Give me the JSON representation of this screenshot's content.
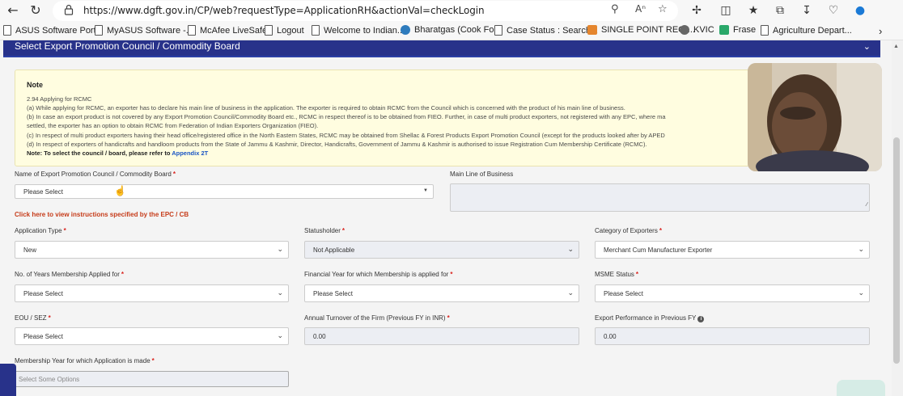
{
  "browser": {
    "url": "https://www.dgft.gov.in/CP/web?requestType=ApplicationRH&actionVal=checkLogin",
    "icons": [
      "back-icon",
      "refresh-icon",
      "lock-icon",
      "zoom-icon",
      "read-aloud-icon",
      "favorite-star-icon",
      "extensions-icon",
      "split-screen-icon",
      "favorites-icon",
      "collections-icon",
      "downloads-icon",
      "performance-icon",
      "copilot-icon"
    ]
  },
  "favorites": [
    {
      "label": "ASUS Software Port..."
    },
    {
      "label": "MyASUS Software -..."
    },
    {
      "label": "McAfee LiveSafe"
    },
    {
      "label": "Logout"
    },
    {
      "label": "Welcome to Indian..."
    },
    {
      "label": "Bharatgas (Cook Fo..."
    },
    {
      "label": "Case Status : Search..."
    },
    {
      "label": "SINGLE POINT REGI..."
    },
    {
      "label": "KVIC"
    },
    {
      "label": "Frase"
    },
    {
      "label": "Agriculture Depart..."
    }
  ],
  "section": {
    "title": "Select Export Promotion Council / Commodity Board"
  },
  "note": {
    "heading": "Note",
    "lines": [
      "2.94 Applying for RCMC",
      "(a) While applying for RCMC, an exporter has to declare his main line of business in the application. The exporter is required to obtain RCMC from the Council which is concerned with the product of his main line of business.",
      "(b) In case an export product is not covered by any Export Promotion Council/Commodity Board etc., RCMC in respect thereof is to be obtained from FIEO. Further, in case of multi product exporters, not registered with any EPC, where ma",
      "settled, the exporter has an option to obtain RCMC from Federation of Indian Exporters Organization (FIEO).",
      "(c) In respect of multi product exporters having their head office/registered office in the North Eastern States, RCMC may be obtained from Shellac & Forest Products Export Promotion Council (except for the products looked after by APED",
      "(d) In respect of exporters of handicrafts and handloom products from the State of Jammu & Kashmir, Director, Handicrafts, Government of Jammu & Kashmir is authorised to issue Registration Cum Membership Certificate (RCMC)."
    ],
    "select_note": "Note: To select the council / board, please refer to",
    "appendix_link": "Appendix 2T"
  },
  "form": {
    "epc_label": "Name of Export Promotion Council / Commodity Board",
    "epc_value": "Please Select",
    "main_line_label": "Main Line of Business",
    "instructions_link": "Click here to view instructions specified by the EPC / CB",
    "application_type_label": "Application Type",
    "application_type_value": "New",
    "statusholder_label": "Statusholder",
    "statusholder_value": "Not Applicable",
    "category_label": "Category of Exporters",
    "category_value": "Merchant Cum Manufacturer Exporter",
    "years_label": "No. of Years Membership Applied for",
    "years_value": "Please Select",
    "fin_year_label": "Financial Year for which Membership is applied for",
    "fin_year_value": "Please Select",
    "msme_label": "MSME Status",
    "msme_value": "Please Select",
    "eou_label": "EOU / SEZ",
    "eou_value": "Please Select",
    "turnover_label": "Annual Turnover of the Firm (Previous FY in INR)",
    "turnover_value": "0.00",
    "export_perf_label": "Export Performance in Previous FY",
    "export_perf_value": "0.00",
    "membership_year_label": "Membership Year for which Application is made",
    "membership_year_placeholder": "Select Some Options"
  },
  "colors": {
    "header_blue": "#28328a",
    "note_bg": "#fffde0",
    "required_red": "#d9231e",
    "link_blue": "#1a55c4",
    "instruction_red": "#c63c1a"
  }
}
